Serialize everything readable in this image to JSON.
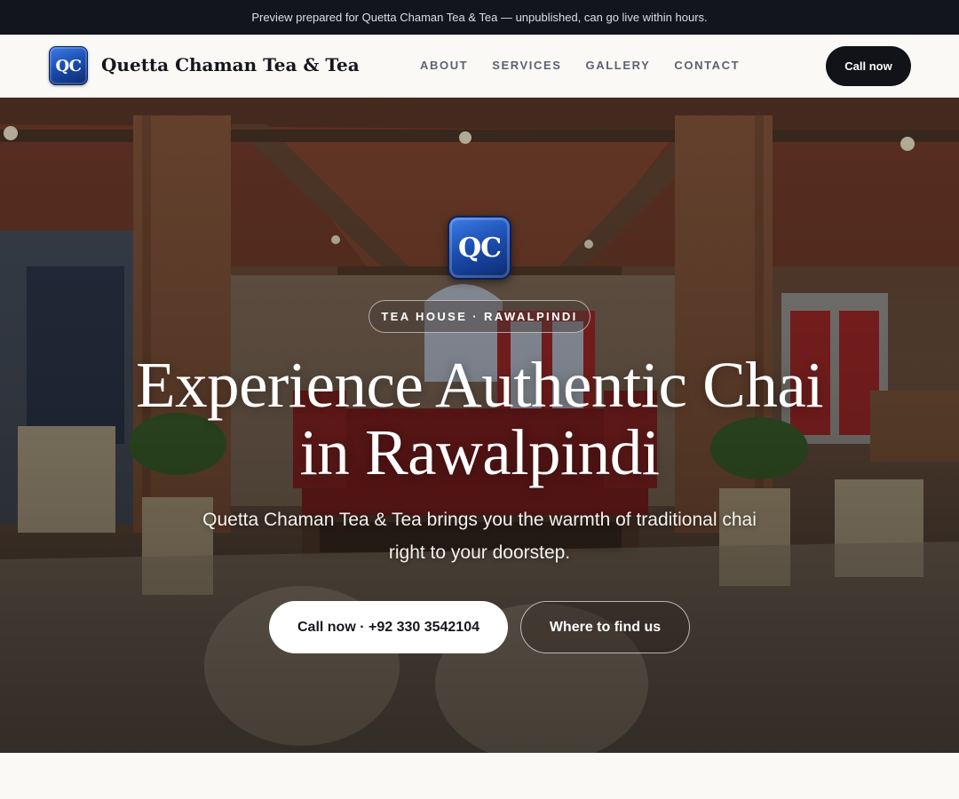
{
  "announcement": "Preview prepared for Quetta Chaman Tea & Tea — unpublished, can go live within hours.",
  "brand": {
    "logo_text": "QC",
    "name": "Quetta Chaman Tea & Tea"
  },
  "nav": {
    "links": [
      "ABOUT",
      "SERVICES",
      "GALLERY",
      "CONTACT"
    ],
    "cta_label": "Call now"
  },
  "hero": {
    "logo_text": "QC",
    "eyebrow": "TEA HOUSE · RAWALPINDI",
    "title_line1": "Experience Authentic Chai",
    "title_line2": "in Rawalpindi",
    "subtitle": "Quetta Chaman Tea & Tea brings you the warmth of traditional chai right to your doorstep.",
    "primary_button": "Call now · +92 330 3542104",
    "secondary_button": "Where to find us"
  },
  "colors": {
    "topbar_bg": "#12151c",
    "nav_cta_bg": "#111319",
    "logo_blue": "#1c4fb3",
    "page_bg": "#faf9f6"
  },
  "icons": {
    "logo": "qc-logo-icon"
  }
}
